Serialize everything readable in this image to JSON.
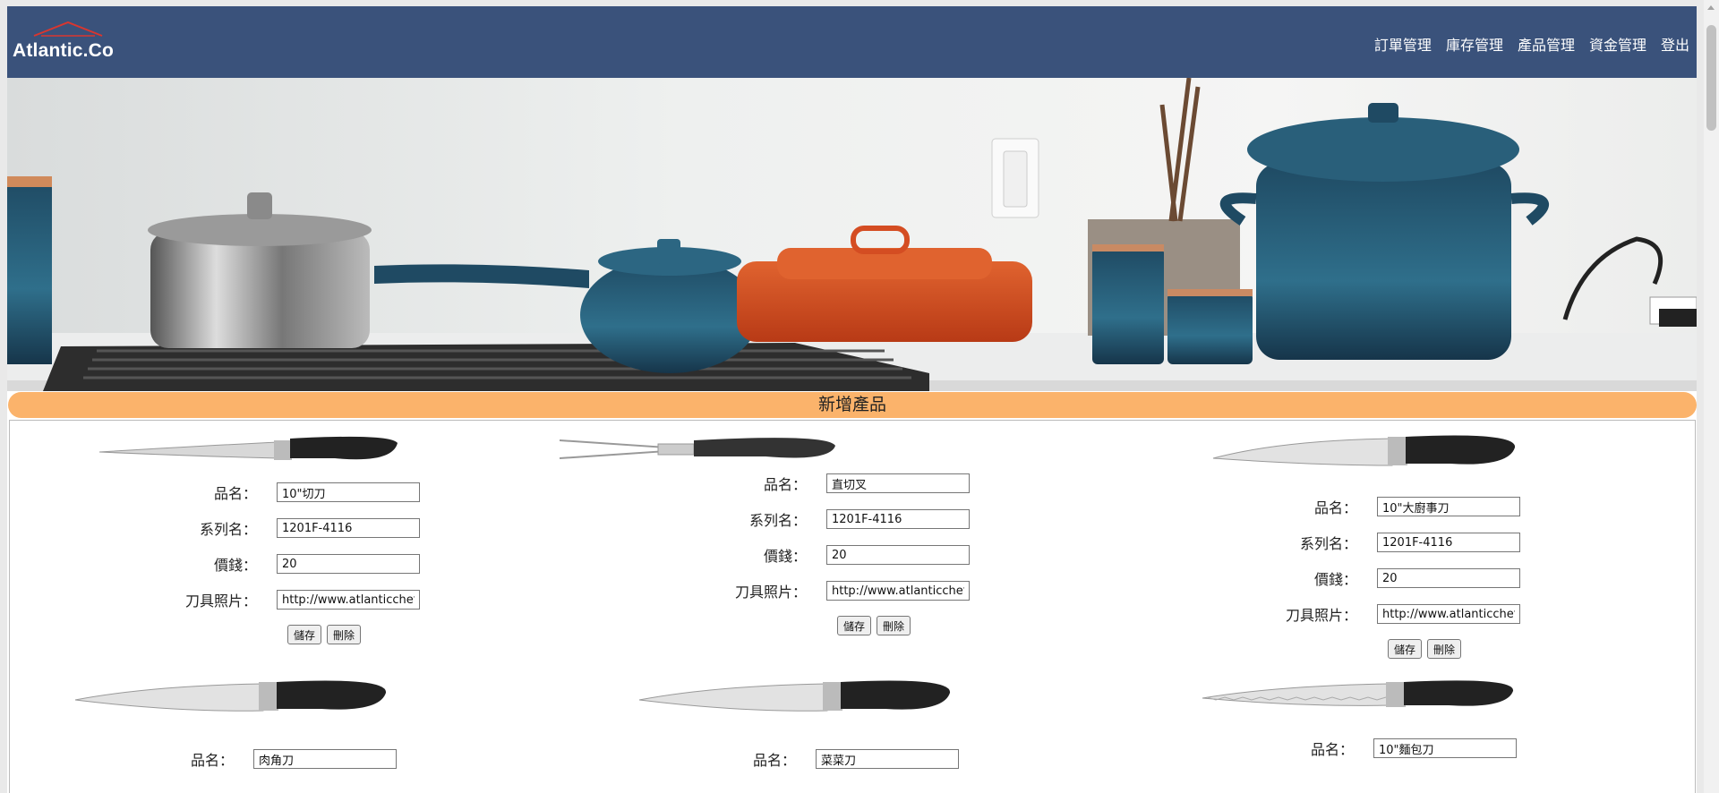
{
  "brand": {
    "logo_text": "Atlantic.Co"
  },
  "nav": {
    "items": [
      "訂單管理",
      "庫存管理",
      "產品管理",
      "資金管理",
      "登出"
    ]
  },
  "add_product_label": "新增產品",
  "labels": {
    "name": "品名：",
    "series": "系列名：",
    "price": "價錢：",
    "photo": "刀具照片：",
    "save": "儲存",
    "delete": "刪除"
  },
  "products": [
    {
      "name": "10\"切刀",
      "series": "1201F-4116",
      "price": "20",
      "photo": "http://www.atlanticchef.com",
      "knife": "slicer"
    },
    {
      "name": "直切叉",
      "series": "1201F-4116",
      "price": "20",
      "photo": "http://www.atlanticchef.com",
      "knife": "fork"
    },
    {
      "name": "10\"大廚事刀",
      "series": "1201F-4116",
      "price": "20",
      "photo": "http://www.atlanticchef.com",
      "knife": "chef"
    },
    {
      "name": "肉角刀",
      "knife": "chef"
    },
    {
      "name": "菜菜刀",
      "knife": "chef"
    },
    {
      "name": "10\"麵包刀",
      "knife": "bread"
    }
  ],
  "colors": {
    "header": "#3a527b",
    "add_bar": "#fbb36b"
  }
}
